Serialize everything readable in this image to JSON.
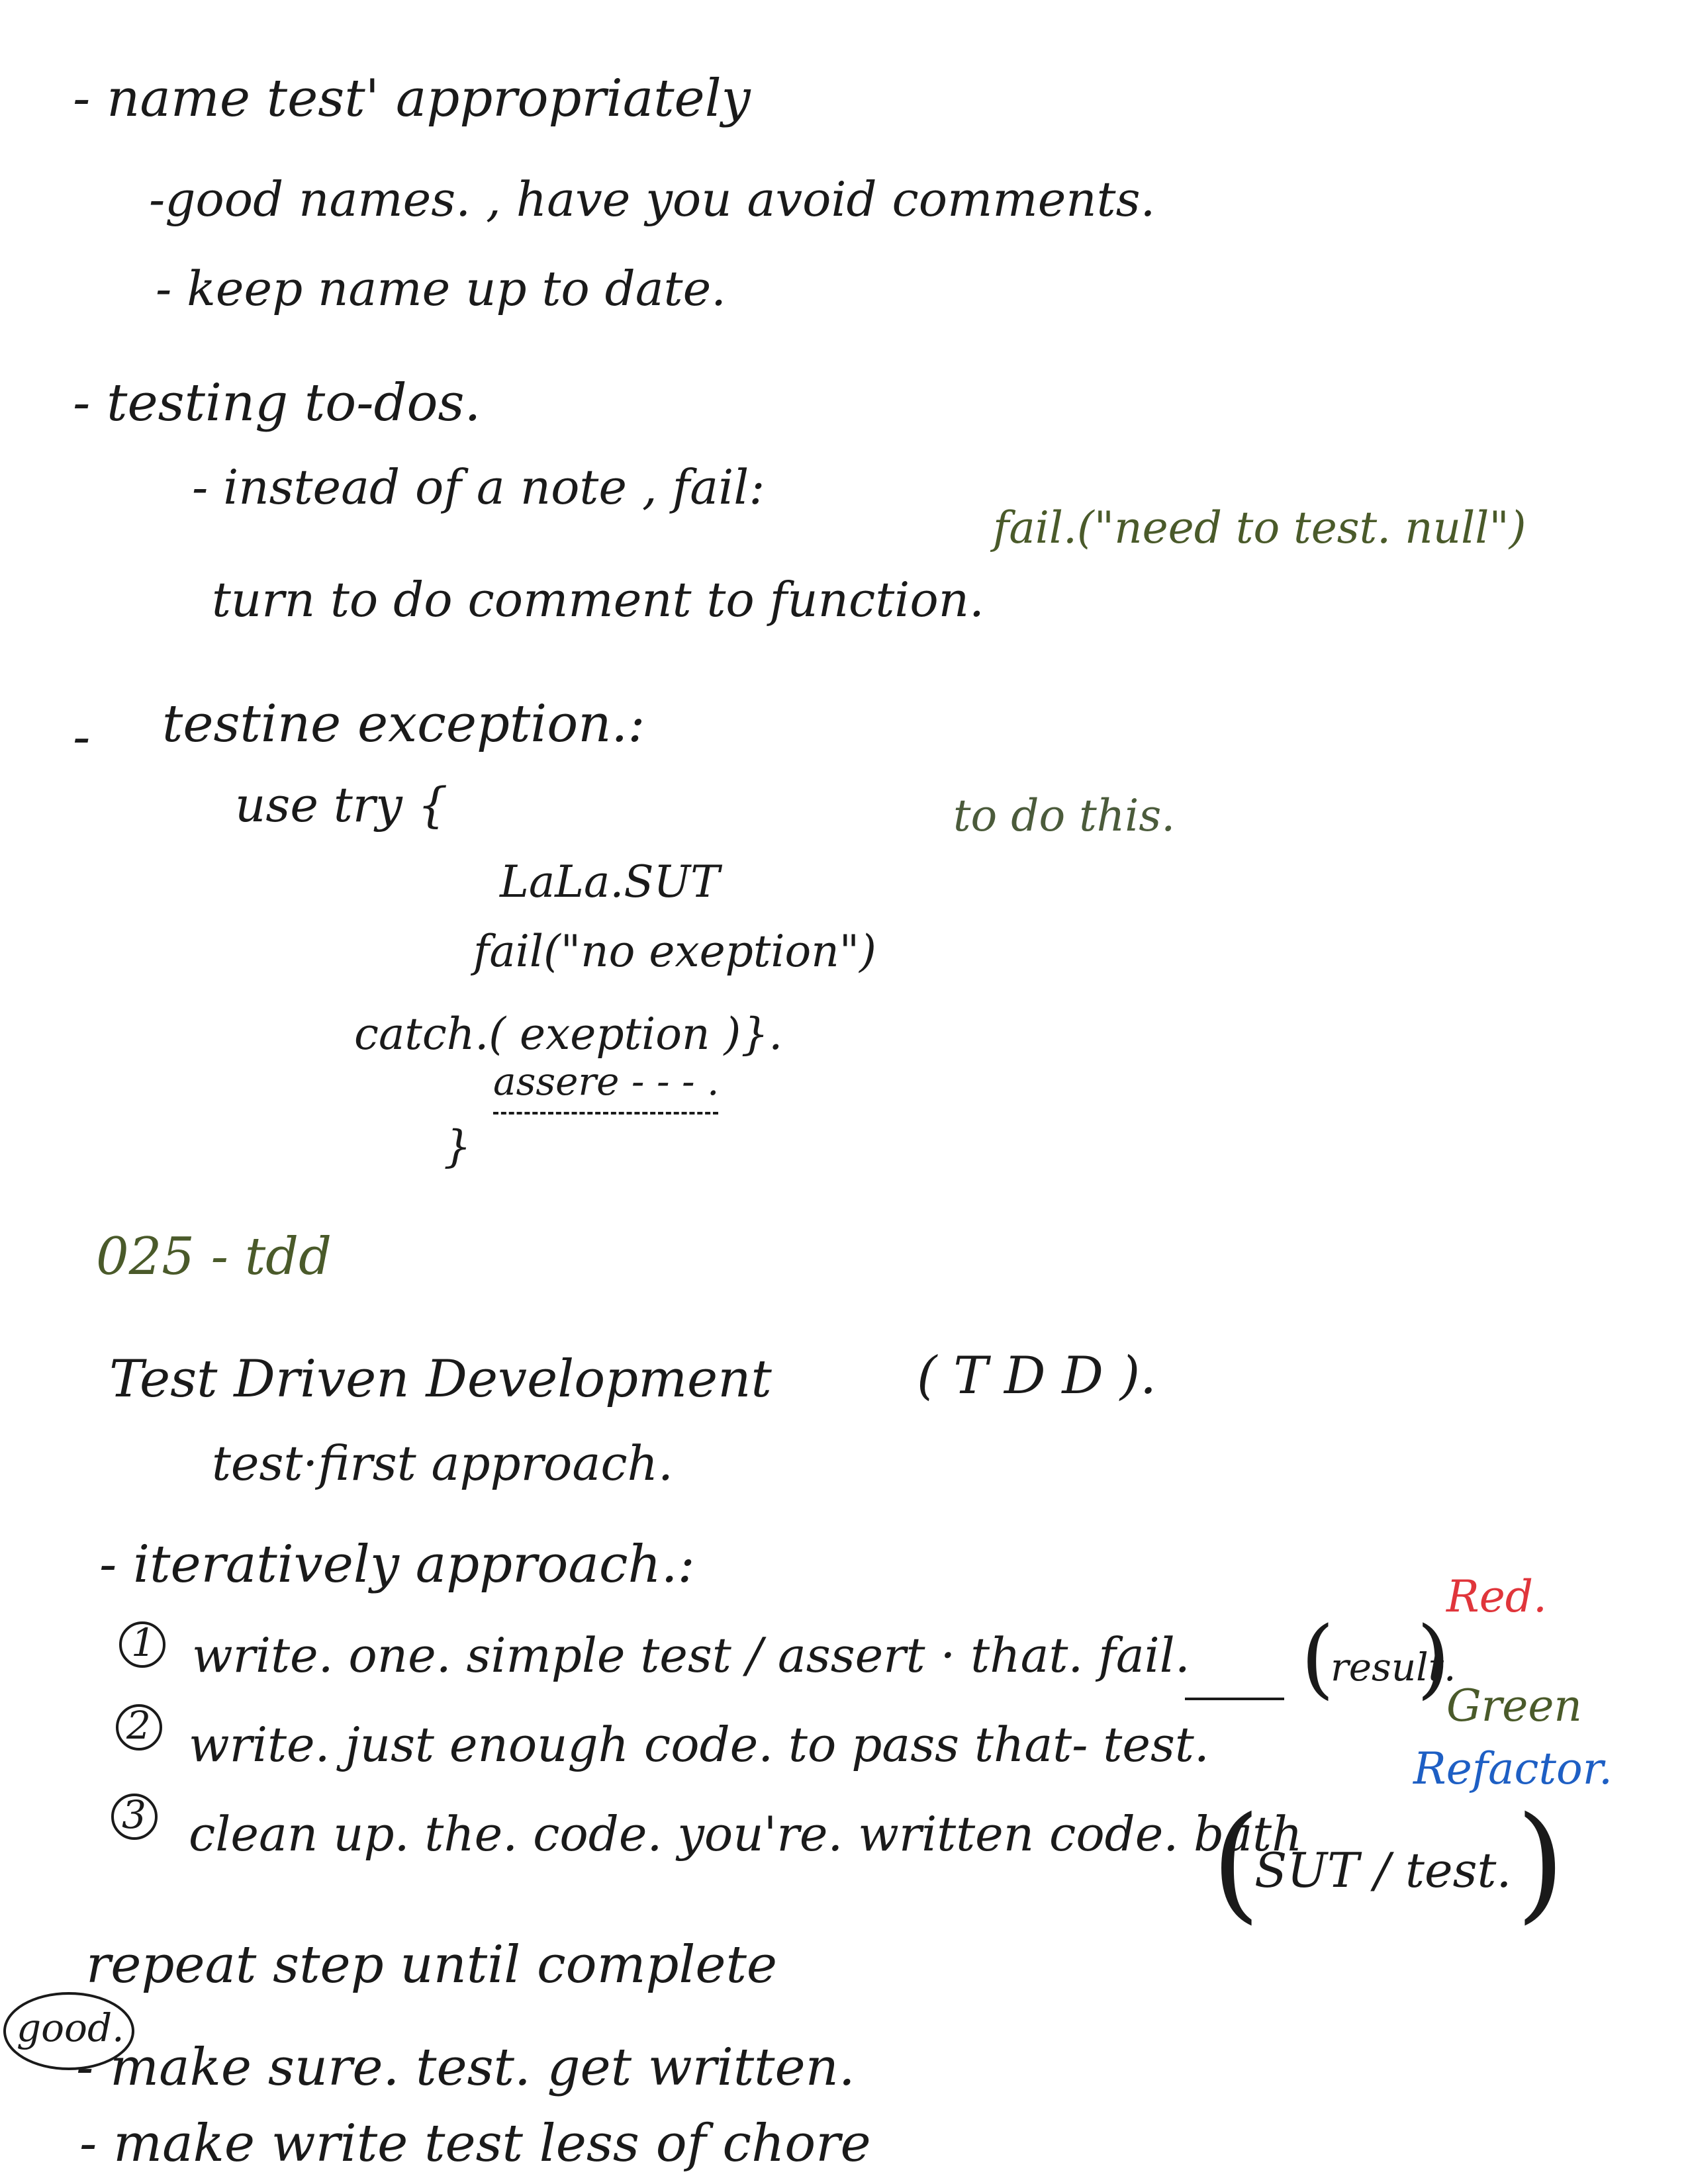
{
  "notes": {
    "l01": "- name test' appropriately",
    "l02": "-good  names.  , have you avoid comments.",
    "l03": "- keep  name  up to date.",
    "l04": "- testing  to-dos.",
    "l05": "- instead  of a note , fail:",
    "l05b": "fail.(\"need to test. null\")",
    "l06": "turn  to do comment  to function.",
    "l07": "-",
    "l07b": "testine  exception.:",
    "l08": "use  try {",
    "l08b": "to do  this.",
    "l09": "LaLa.SUT",
    "l10": "fail(\"no exeption\")",
    "l11": "catch.(     exeption    )}.",
    "l12": "assere - - - .",
    "l13": "}",
    "l14": "025 - tdd",
    "l15": "Test  Driven  Development",
    "l15b": "( T D D ).",
    "l16": "test·first approach.",
    "l17": "- iteratively approach.:",
    "l18label": "Red.",
    "l18num": "1",
    "l18": "write.  one.  simple test / assert · that. fail.",
    "l18b": "result.",
    "l19label": "Green",
    "l19num": "2",
    "l19": "write. just   enough code.  to  pass that- test.",
    "l19b": "Refactor.",
    "l20num": "3",
    "l20": "clean up.  the. code.  you're. written code.  bath",
    "l20b": "SUT / test.",
    "l21": "repeat  step  until  complete",
    "l22good": "good.",
    "l22": "- make sure.  test.  get written.",
    "l23": "- make  write test   less  of  chore"
  }
}
